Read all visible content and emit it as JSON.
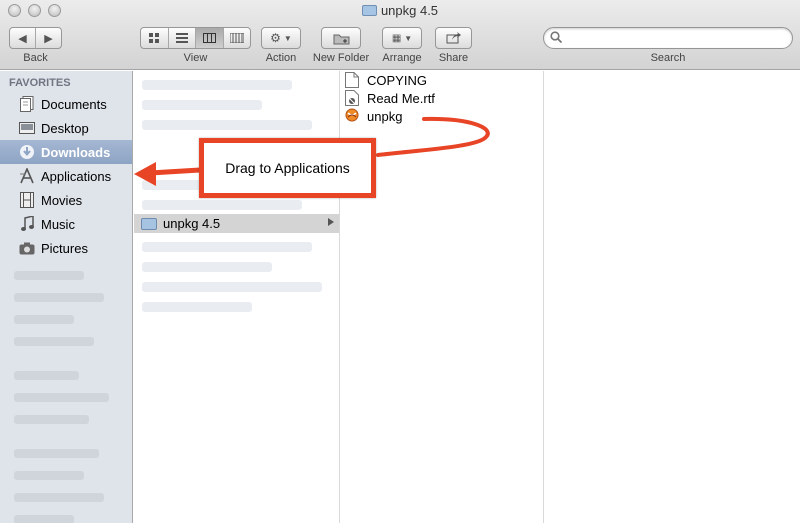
{
  "window": {
    "title": "unpkg 4.5"
  },
  "toolbar": {
    "back_label": "Back",
    "view_label": "View",
    "action_label": "Action",
    "new_folder_label": "New Folder",
    "arrange_label": "Arrange",
    "share_label": "Share",
    "search_label": "Search",
    "search_placeholder": ""
  },
  "sidebar": {
    "heading": "FAVORITES",
    "items": [
      {
        "label": "Documents",
        "icon": "documents-icon"
      },
      {
        "label": "Desktop",
        "icon": "desktop-icon"
      },
      {
        "label": "Downloads",
        "icon": "downloads-icon",
        "selected": true
      },
      {
        "label": "Applications",
        "icon": "applications-icon"
      },
      {
        "label": "Movies",
        "icon": "movies-icon"
      },
      {
        "label": "Music",
        "icon": "music-icon"
      },
      {
        "label": "Pictures",
        "icon": "pictures-icon"
      }
    ]
  },
  "column1": {
    "selected_folder": "unpkg 4.5"
  },
  "column2": {
    "files": [
      {
        "name": "COPYING",
        "icon": "text-file-icon"
      },
      {
        "name": "Read Me.rtf",
        "icon": "rtf-file-icon"
      },
      {
        "name": "unpkg",
        "icon": "unpkg-app-icon"
      }
    ]
  },
  "annotation": {
    "text": "Drag to Applications",
    "color": "#e84426"
  },
  "colors": {
    "selection": "#94a9c8",
    "sidebar_bg": "#dfe3ea",
    "accent": "#e84426"
  }
}
